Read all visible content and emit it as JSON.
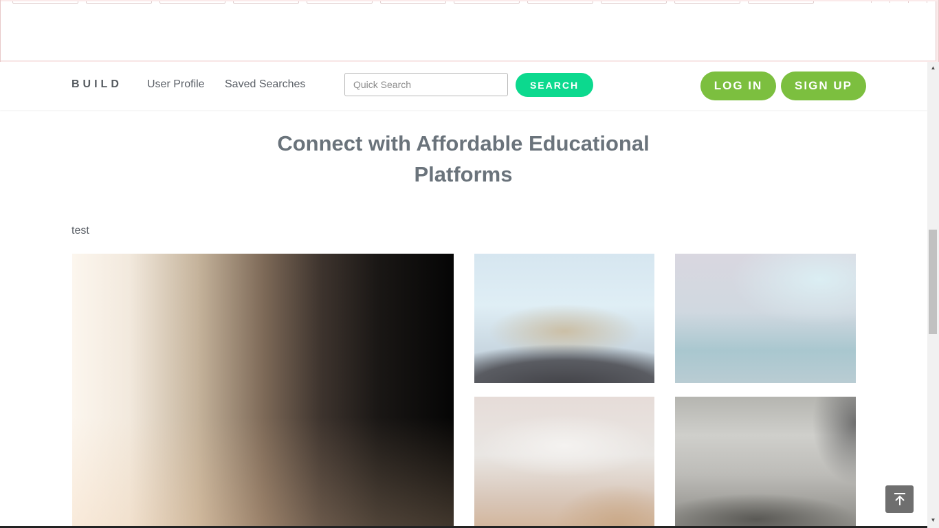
{
  "header": {
    "brand": "BUILD",
    "nav": [
      {
        "label": "User Profile"
      },
      {
        "label": "Saved Searches"
      }
    ],
    "search": {
      "placeholder": "Quick Search",
      "value": "",
      "button_label": "SEARCH"
    },
    "login_label": "LOG IN",
    "signup_label": "SIGN UP"
  },
  "main": {
    "title_line1": "Connect with Affordable Educational",
    "title_line2": "Platforms",
    "section_label": "test"
  },
  "colors": {
    "search_button": "#0cd98e",
    "auth_buttons": "#7cbf3f",
    "title_text": "#6a737b"
  },
  "icons": {
    "back_to_top": "arrow-up-to-line-icon"
  }
}
